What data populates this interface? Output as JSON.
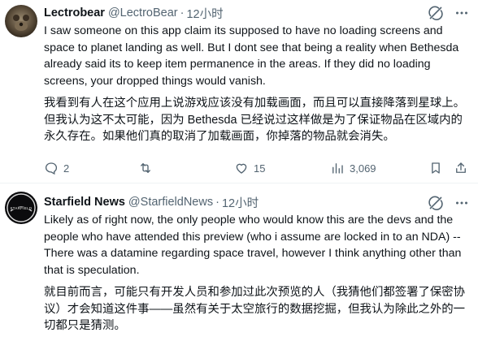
{
  "tweets": [
    {
      "author": "Lectrobear",
      "handle": "@LectroBear",
      "separator": "·",
      "time": "12小时",
      "text_en": "I saw someone on this app claim its supposed to have no loading screens and space to planet landing as well. But I dont see that being a reality when Bethesda already said its to keep item permanence in the areas. If they did no loading screens, your dropped things would vanish.",
      "text_zh": "我看到有人在这个应用上说游戏应该没有加载画面，而且可以直接降落到星球上。但我认为这不太可能，因为 Bethesda 已经说过这样做是为了保证物品在区域内的永久存在。如果他们真的取消了加载画面，你掉落的物品就会消失。",
      "replies": "2",
      "retweets": "",
      "likes": "15",
      "views": "3,069"
    },
    {
      "author": "Starfield News",
      "handle": "@StarfieldNews",
      "separator": "·",
      "time": "12小时",
      "text_en": "Likely as of right now, the only people who would know this are the devs and the people who have attended this preview (who i assume are locked in to an NDA) -- There was a datamine regarding space travel, however I think anything other than that is speculation.",
      "text_zh": "就目前而言，可能只有开发人员和参加过此次预览的人（我猜他们都签署了保密协议）才会知道这件事——虽然有关于太空旅行的数据挖掘，但我认为除此之外的一切都只是猜测。"
    }
  ],
  "icons": {
    "grok": "grok-icon",
    "more": "more-icon",
    "reply": "reply-icon",
    "retweet": "retweet-icon",
    "like": "like-icon",
    "views": "views-icon",
    "bookmark": "bookmark-icon",
    "share": "share-icon"
  },
  "colors": {
    "text": "#0f1419",
    "muted": "#536471",
    "divider": "#eff3f4"
  }
}
